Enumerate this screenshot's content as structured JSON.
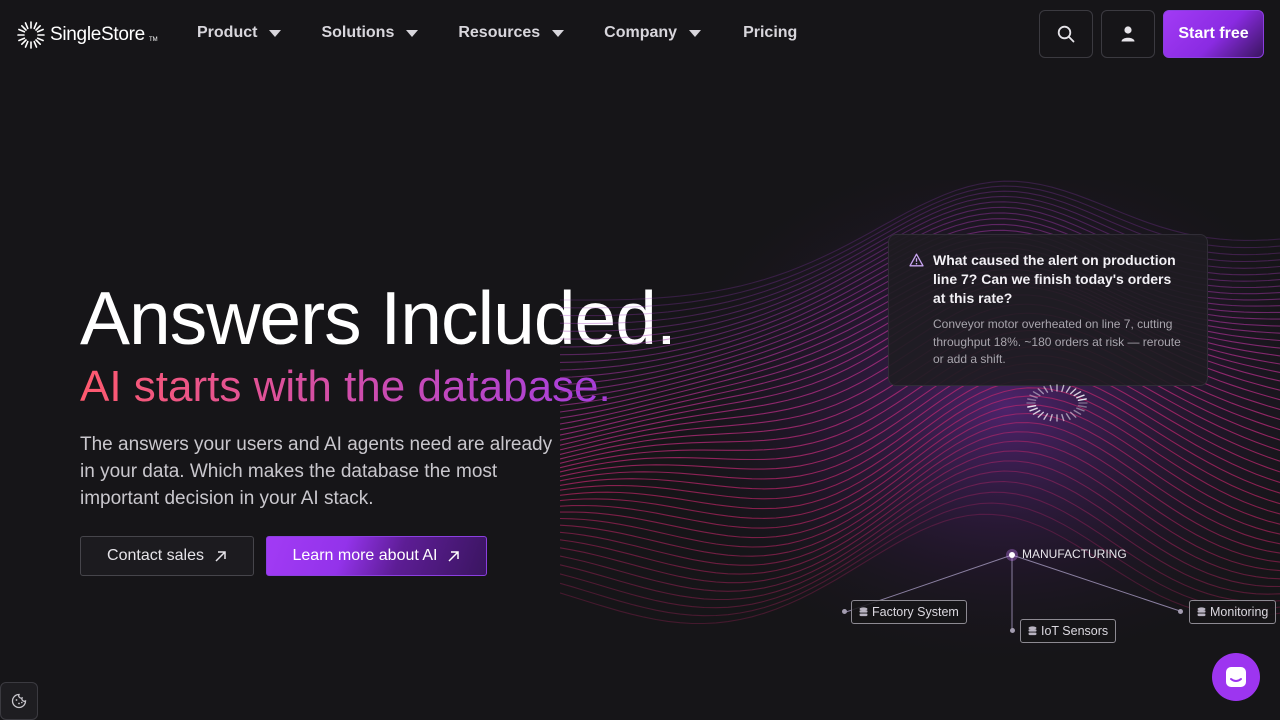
{
  "brand": {
    "name": "SingleStore",
    "tm": "TM"
  },
  "nav": {
    "items": [
      {
        "label": "Product",
        "has_menu": true
      },
      {
        "label": "Solutions",
        "has_menu": true
      },
      {
        "label": "Resources",
        "has_menu": true
      },
      {
        "label": "Company",
        "has_menu": true
      },
      {
        "label": "Pricing",
        "has_menu": false
      }
    ],
    "search_icon": "search-icon",
    "account_icon": "user-icon",
    "cta_label": "Start free"
  },
  "hero": {
    "title": "Answers Included.",
    "subtitle": "AI starts with the database.",
    "description": "The answers your users and AI agents need are already in your data. Which makes the database the most important decision in your AI stack.",
    "primary_label": "Contact sales",
    "secondary_label": "Learn more about AI"
  },
  "alert": {
    "question": "What caused the alert on production line 7? Can we finish today's orders at this rate?",
    "answer": "Conveyor motor overheated on line 7, cutting throughput 18%. ~180 orders at risk — reroute or add a shift."
  },
  "graph": {
    "hub": "MANUFACTURING",
    "nodes": [
      "Factory System",
      "IoT Sensors",
      "Monitoring"
    ]
  },
  "colors": {
    "background": "#161518",
    "accent": "#9d35f0",
    "gradient_start": "#ff5a6e",
    "gradient_end": "#a43ee0"
  }
}
